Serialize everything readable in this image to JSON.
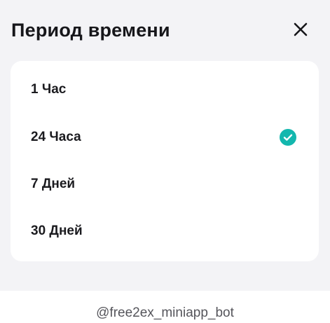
{
  "sheet": {
    "title": "Период времени",
    "close_icon": "close-icon"
  },
  "options": [
    {
      "label": "1 Час",
      "selected": false
    },
    {
      "label": "24 Часа",
      "selected": true
    },
    {
      "label": "7 Дней",
      "selected": false
    },
    {
      "label": "30 Дней",
      "selected": false
    }
  ],
  "check_icon": "check-circle-icon",
  "accent_color": "#13b7ae",
  "footer": {
    "bot_handle": "@free2ex_miniapp_bot"
  }
}
